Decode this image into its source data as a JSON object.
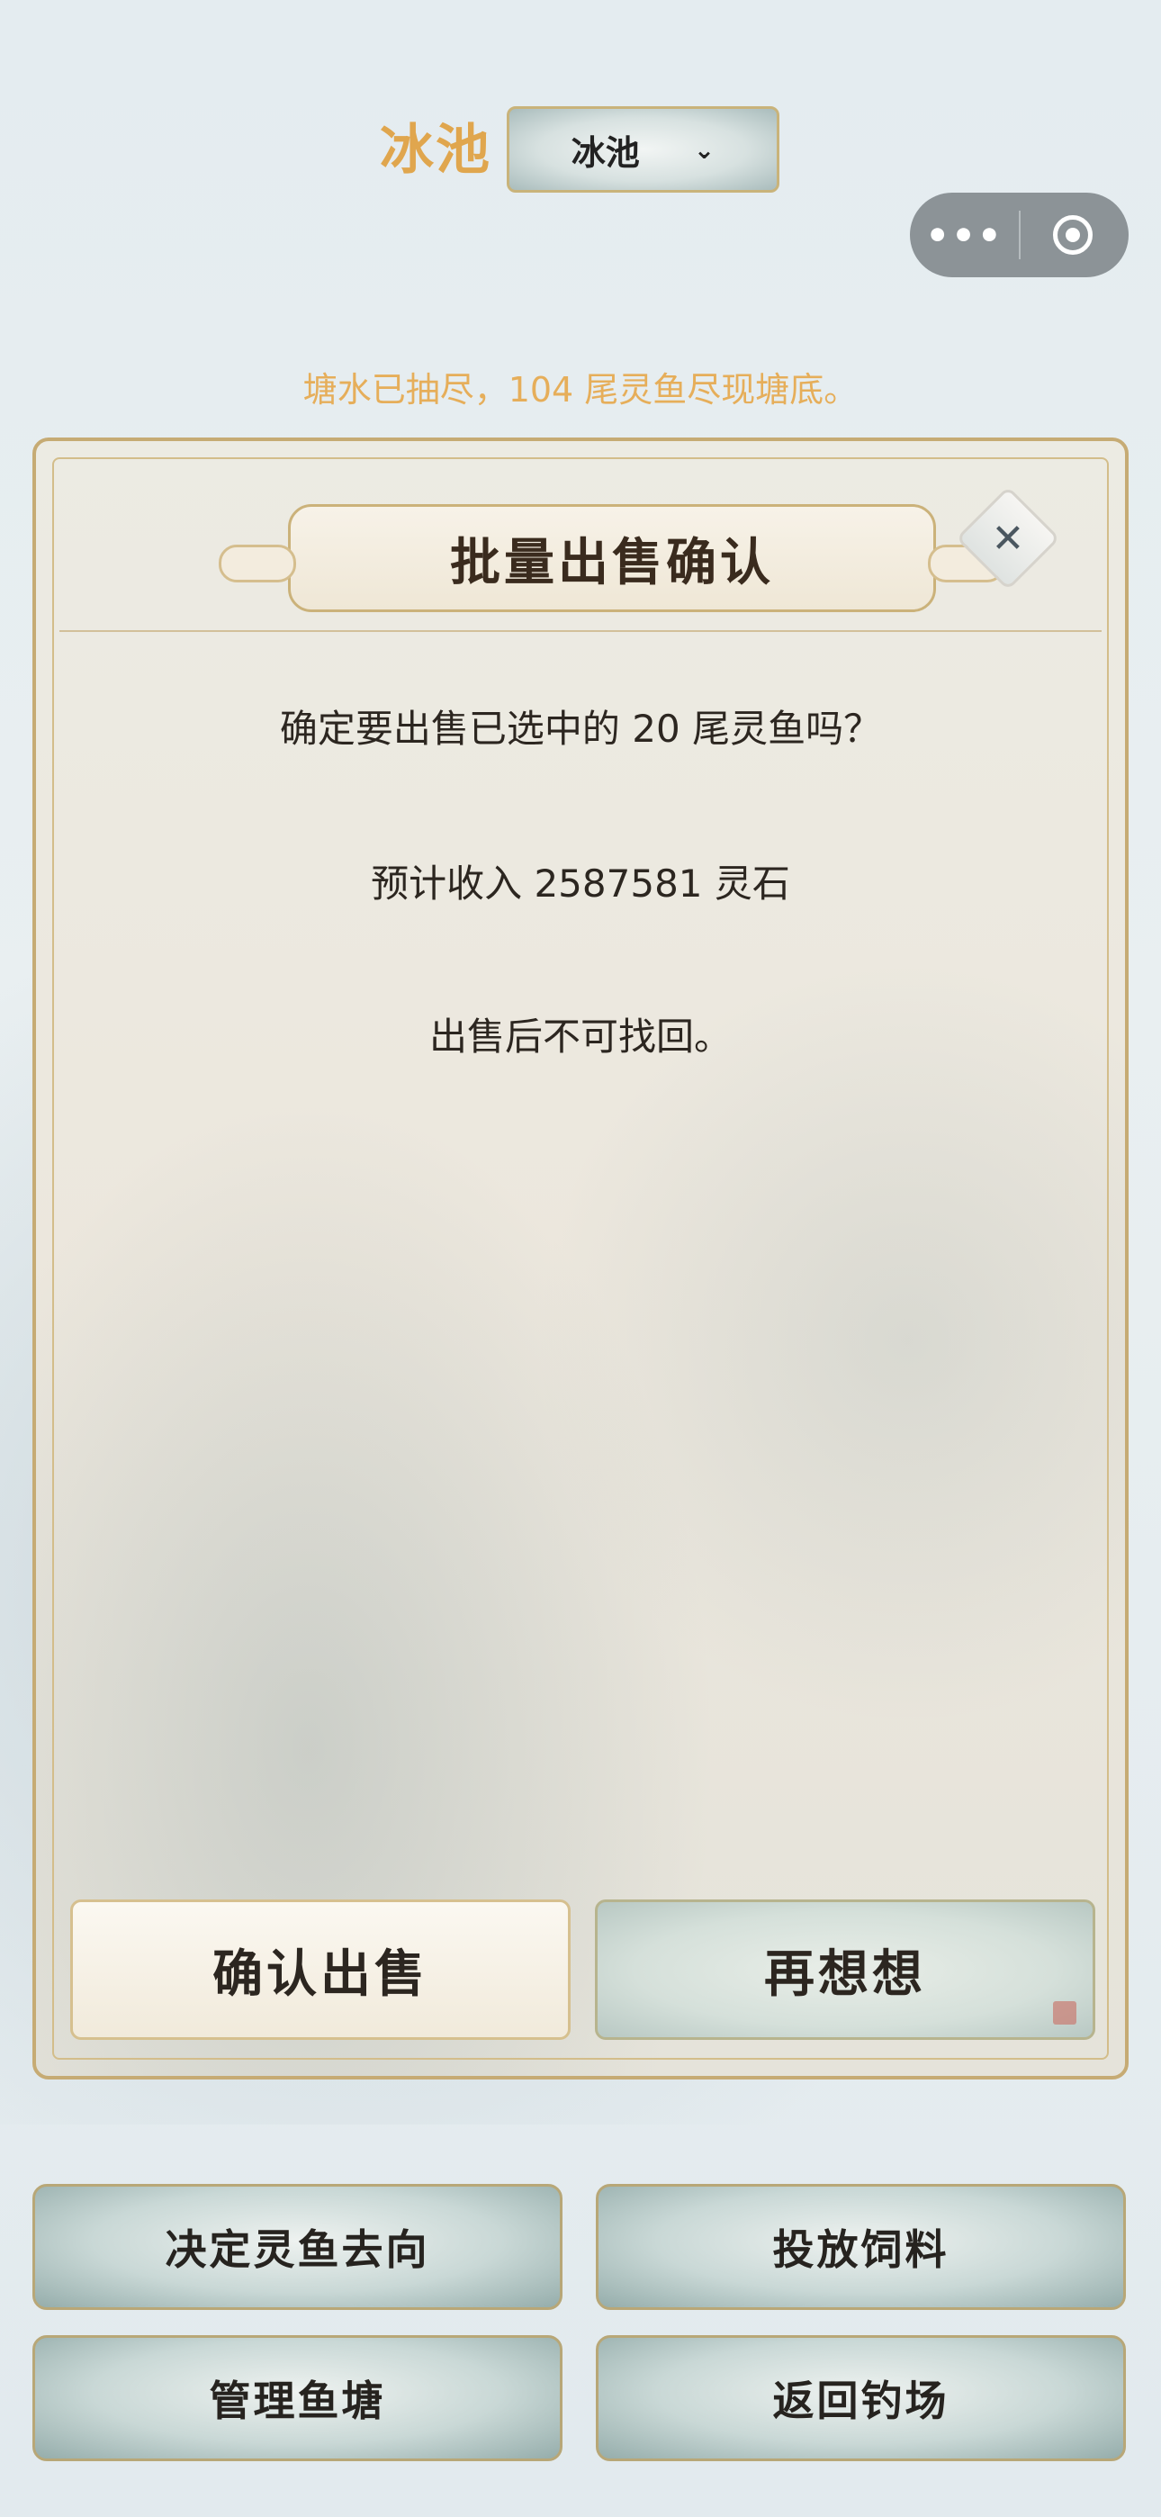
{
  "header": {
    "pool_label": "冰池",
    "pool_select_value": "冰池",
    "capsule_more": "•••"
  },
  "status_text": "塘水已抽尽，104 尾灵鱼尽现塘底。",
  "dialog": {
    "title": "批量出售确认",
    "close_glyph": "✕",
    "line1": "确定要出售已选中的 20 尾灵鱼吗？",
    "line2": "预计收入 2587581 灵石",
    "line3": "出售后不可找回。",
    "confirm_label": "确认出售",
    "cancel_label": "再想想"
  },
  "actions": {
    "decide_fish": "决定灵鱼去向",
    "feed": "投放饲料",
    "manage_pond": "管理鱼塘",
    "back": "返回钓场"
  },
  "colors": {
    "accent_gold": "#e0a64e",
    "dialog_border": "#c6ab74",
    "text_dark": "#2c2620"
  }
}
